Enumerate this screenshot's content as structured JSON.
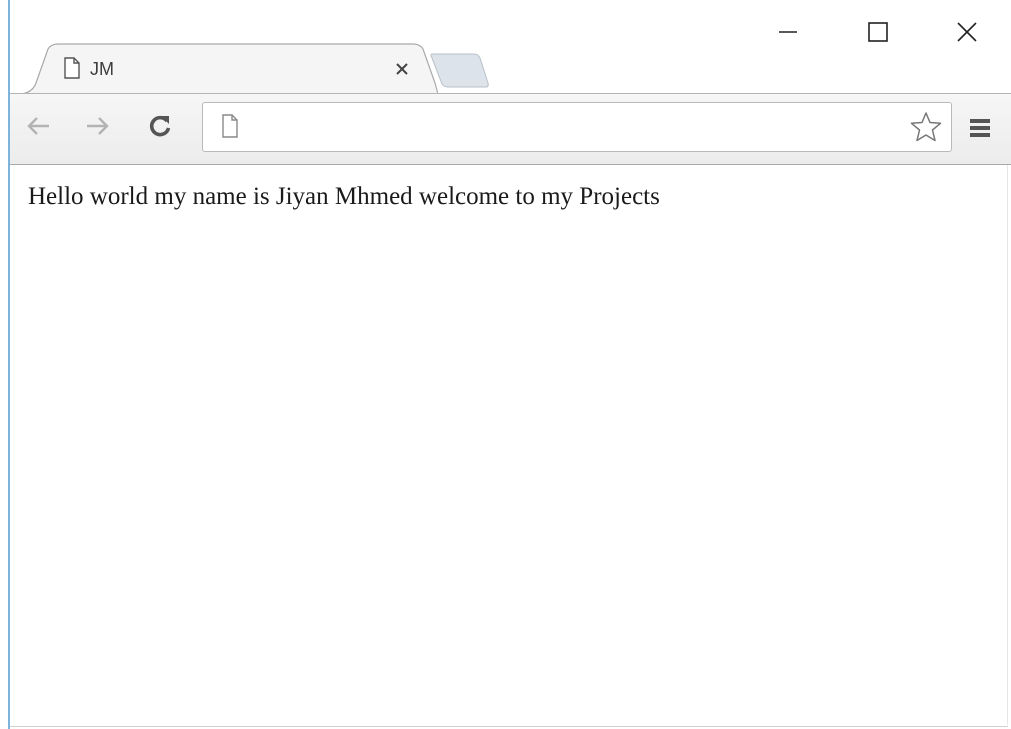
{
  "window": {
    "controls": {
      "minimize_icon": "minimize-icon",
      "maximize_icon": "maximize-icon",
      "close_icon": "close-icon"
    }
  },
  "tabs": [
    {
      "title": "JM",
      "icon": "document-icon",
      "close_icon": "close-icon",
      "active": true
    }
  ],
  "new_tab": {
    "icon": "new-tab-icon"
  },
  "toolbar": {
    "back_icon": "arrow-left-icon",
    "forward_icon": "arrow-right-icon",
    "reload_icon": "reload-icon",
    "menu_icon": "hamburger-menu-icon"
  },
  "omnibox": {
    "value": "",
    "page_icon": "document-icon",
    "bookmark_icon": "star-icon"
  },
  "page": {
    "text": "Hello world my name is Jiyan Mhmed welcome to my Projects"
  },
  "colors": {
    "window_accent": "#7eb4dc",
    "toolbar_bg": "#f2f2f2",
    "text": "#1a1a1a"
  }
}
